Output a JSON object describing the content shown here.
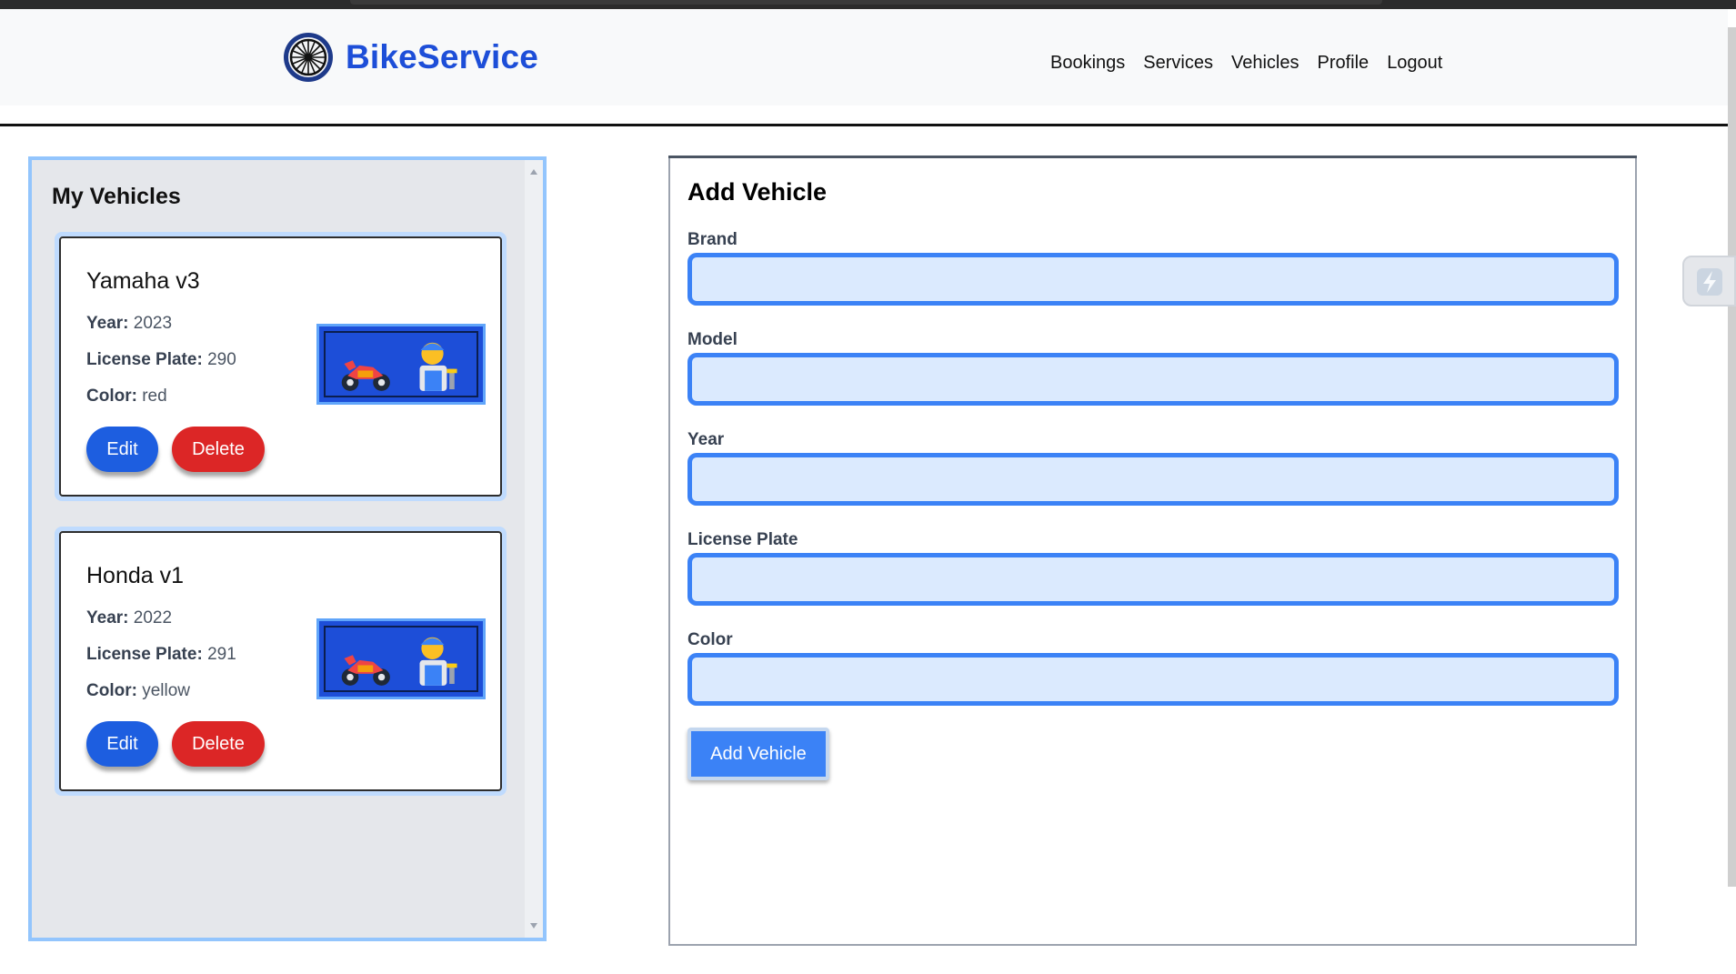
{
  "app": {
    "brand": "BikeService",
    "logo_icon": "wheel-icon",
    "accent_color": "#1d4ed8"
  },
  "nav": {
    "items": [
      "Bookings",
      "Services",
      "Vehicles",
      "Profile",
      "Logout"
    ]
  },
  "vehicles_panel": {
    "title": "My Vehicles",
    "vehicles": [
      {
        "name": "Yamaha v3",
        "year_label": "Year:",
        "year": "2023",
        "plate_label": "License Plate:",
        "plate": "290",
        "color_label": "Color:",
        "color": "red",
        "image_icon": "motorcycle-mechanic-icon",
        "edit_label": "Edit",
        "delete_label": "Delete"
      },
      {
        "name": "Honda v1",
        "year_label": "Year:",
        "year": "2022",
        "plate_label": "License Plate:",
        "plate": "291",
        "color_label": "Color:",
        "color": "yellow",
        "image_icon": "motorcycle-mechanic-icon",
        "edit_label": "Edit",
        "delete_label": "Delete"
      }
    ]
  },
  "add_form": {
    "title": "Add Vehicle",
    "fields": [
      {
        "label": "Brand",
        "value": ""
      },
      {
        "label": "Model",
        "value": ""
      },
      {
        "label": "Year",
        "value": ""
      },
      {
        "label": "License Plate",
        "value": ""
      },
      {
        "label": "Color",
        "value": ""
      }
    ],
    "submit_label": "Add Vehicle"
  },
  "colors": {
    "edit_button": "#1d5ee0",
    "delete_button": "#dc2626",
    "input_border": "#3b82f6",
    "input_fill": "#dbeafe"
  }
}
